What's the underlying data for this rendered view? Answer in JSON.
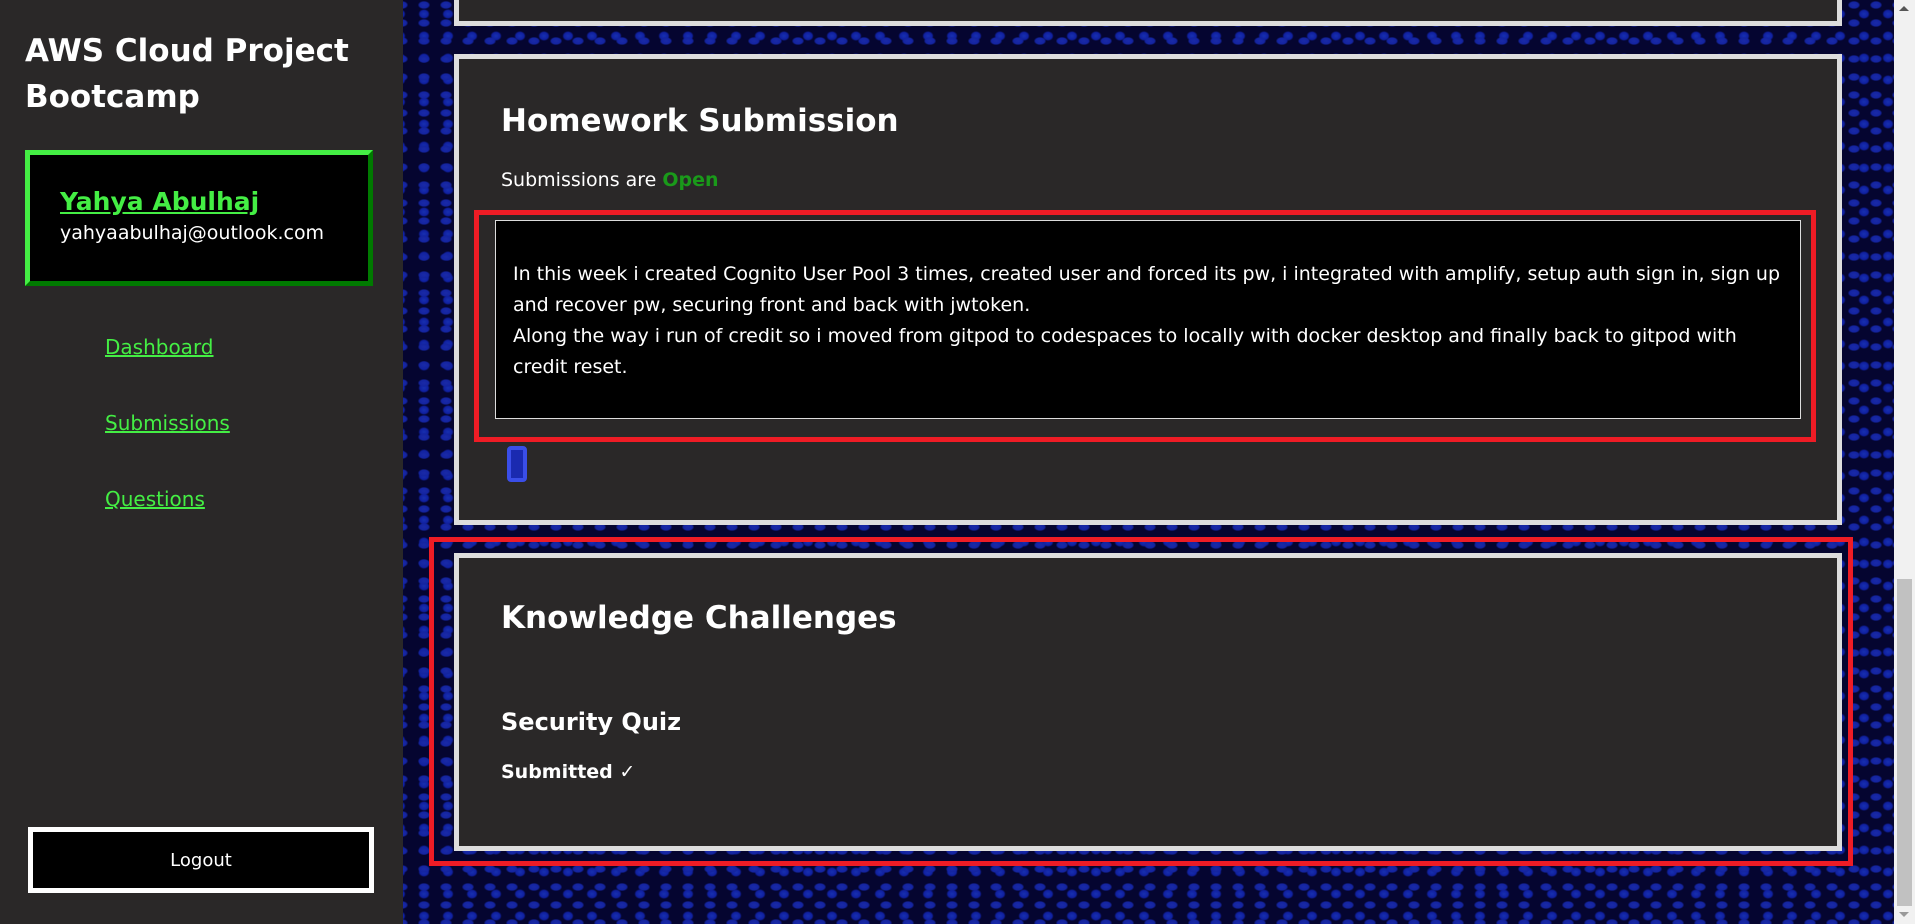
{
  "sidebar": {
    "title": "AWS Cloud Project Bootcamp",
    "user": {
      "name": "Yahya Abulhaj",
      "email": "yahyaabulhaj@outlook.com"
    },
    "nav": [
      {
        "label": "Dashboard"
      },
      {
        "label": "Submissions"
      },
      {
        "label": "Questions"
      }
    ],
    "logout_label": "Logout"
  },
  "homework": {
    "title": "Homework Submission",
    "status_prefix": "Submissions are",
    "status": "Open",
    "text": "In this week i created Cognito User Pool 3 times, created user and forced its pw, i integrated with amplify, setup auth sign in, sign up and recover pw, securing front and back with jwtoken.\nAlong the way i run of credit so i moved from gitpod to codespaces to locally with docker desktop and finally back to gitpod with credit reset.",
    "icon": "grammarly-like-extension-icon"
  },
  "knowledge": {
    "title": "Knowledge Challenges",
    "quiz": {
      "name": "Security Quiz",
      "status": "Submitted",
      "icon": "checkmark-icon"
    }
  },
  "colors": {
    "accent": "#44ee44",
    "open": "#1a9a1a",
    "highlight": "#ee1c25",
    "panel": "#2a2828"
  }
}
